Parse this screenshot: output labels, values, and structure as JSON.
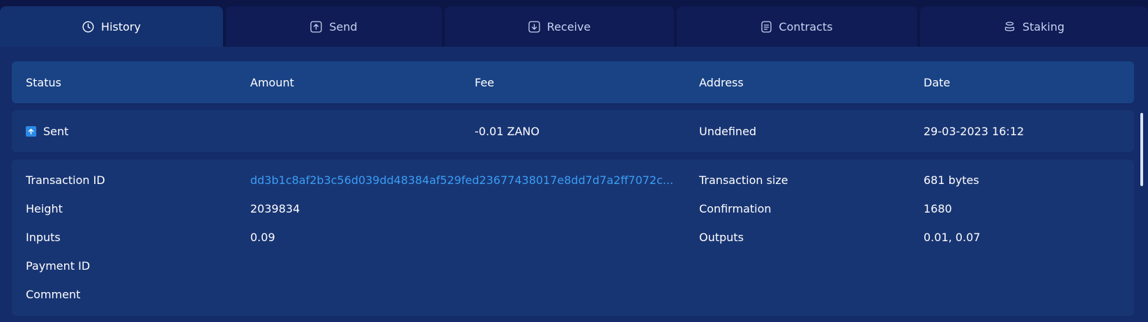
{
  "tabs": [
    {
      "label": "History",
      "icon": "clock-icon"
    },
    {
      "label": "Send",
      "icon": "send-icon"
    },
    {
      "label": "Receive",
      "icon": "receive-icon"
    },
    {
      "label": "Contracts",
      "icon": "contract-icon"
    },
    {
      "label": "Staking",
      "icon": "staking-icon"
    }
  ],
  "table": {
    "headers": [
      "Status",
      "Amount",
      "Fee",
      "Address",
      "Date"
    ],
    "row": {
      "status": "Sent",
      "amount": "",
      "fee": "-0.01 ZANO",
      "address": "Undefined",
      "date": "29-03-2023 16:12"
    }
  },
  "details": {
    "transaction_id_label": "Transaction ID",
    "transaction_id_value": "dd3b1c8af2b3c56d039dd48384af529fed23677438017e8dd7d7a2ff7072c...",
    "transaction_size_label": "Transaction size",
    "transaction_size_value": "681 bytes",
    "height_label": "Height",
    "height_value": "2039834",
    "confirmation_label": "Confirmation",
    "confirmation_value": "1680",
    "inputs_label": "Inputs",
    "inputs_value": "0.09",
    "outputs_label": "Outputs",
    "outputs_value": "0.01, 0.07",
    "payment_id_label": "Payment ID",
    "comment_label": "Comment"
  },
  "colors": {
    "background": "#0c1647",
    "active_tab": "#143170",
    "header": "#1a4386",
    "row": "#183573",
    "link": "#3a9ef5",
    "status_icon": "#2b8ae8"
  }
}
